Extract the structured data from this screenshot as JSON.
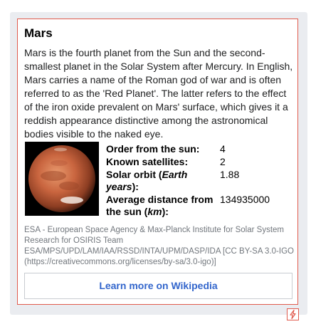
{
  "card": {
    "title": "Mars",
    "extract": "Mars is the fourth planet from the Sun and the second-smallest planet in the Solar System after Mercury. In English, Mars carries a name of the Roman god of war and is often referred to as the 'Red Planet'. The latter refers to the effect of the iron oxide prevalent on Mars' surface, which gives it a reddish appearance distinctive among the astronomical bodies visible to the naked eye.",
    "facts": [
      {
        "label": "Order from the sun:",
        "value": "4"
      },
      {
        "label": "Known satellites:",
        "value": "2"
      },
      {
        "label_parts": [
          "Solar orbit (",
          "Earth years",
          "):"
        ],
        "value": "1.88"
      },
      {
        "label_parts": [
          "Average distance from the sun (",
          "km",
          "):"
        ],
        "value": "134935000"
      }
    ],
    "attribution": "ESA - European Space Agency & Max-Planck Institute for Solar System Research for OSIRIS Team ESA/MPS/UPD/LAM/IAA/RSSD/INTA/UPM/DASP/IDA [CC BY-SA 3.0-IGO (https://creativecommons.org/licenses/by-sa/3.0-igo)]",
    "learn_more_label": "Learn more on Wikipedia"
  },
  "icons": {
    "image": "mars-planet-image",
    "corner": "lightning-icon"
  },
  "colors": {
    "accent_border": "#e05a4d",
    "link": "#3366cc",
    "frame_bg": "#eaecf0"
  }
}
